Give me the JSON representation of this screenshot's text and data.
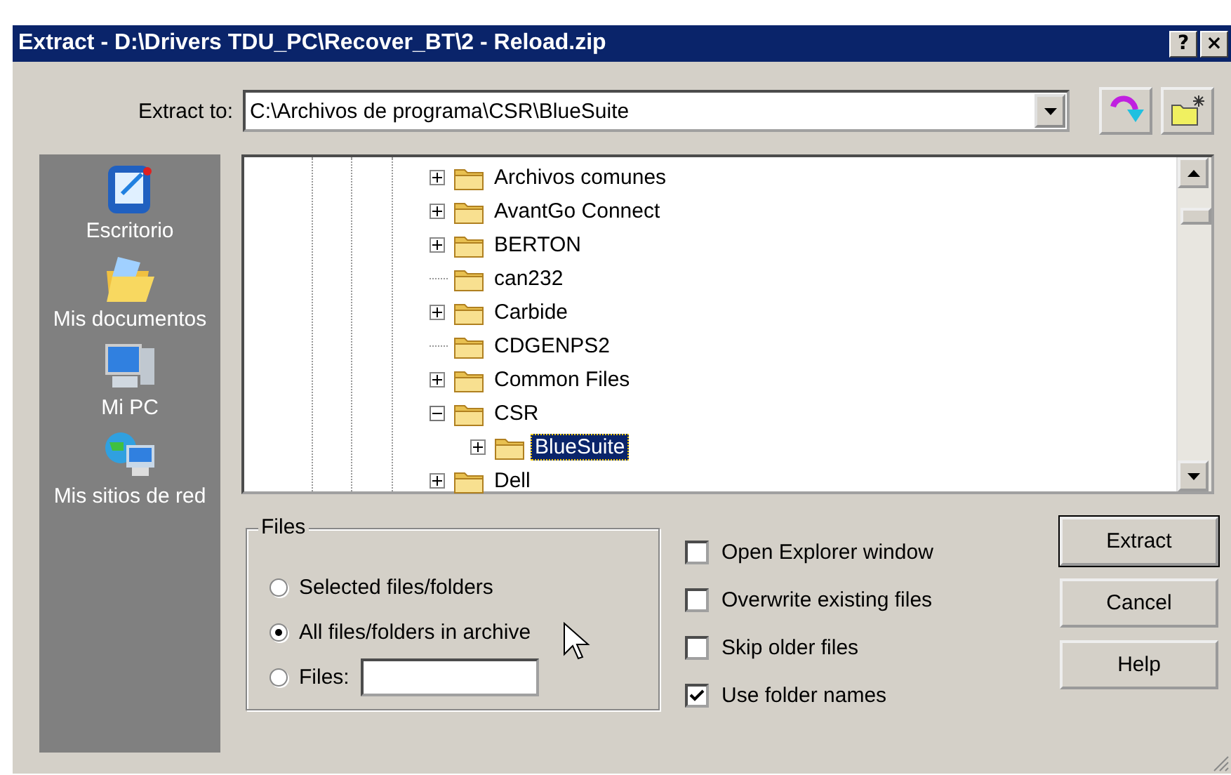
{
  "window": {
    "title": "Extract - D:\\Drivers TDU_PC\\Recover_BT\\2 - Reload.zip",
    "title_buttons": [
      "?",
      "×"
    ]
  },
  "extract_to": {
    "label": "Extract to:",
    "value": "C:\\Archivos de programa\\CSR\\BlueSuite"
  },
  "places": [
    {
      "label": "Escritorio",
      "kind": "desktop"
    },
    {
      "label": "Mis documentos",
      "kind": "documents"
    },
    {
      "label": "Mi PC",
      "kind": "computer"
    },
    {
      "label": "Mis sitios de red",
      "kind": "network"
    }
  ],
  "tree": [
    {
      "label": "Archivos comunes",
      "expandable": true,
      "expanded": false,
      "selected": false
    },
    {
      "label": "AvantGo Connect",
      "expandable": true,
      "expanded": false,
      "selected": false
    },
    {
      "label": "BERTON",
      "expandable": true,
      "expanded": false,
      "selected": false
    },
    {
      "label": "can232",
      "expandable": false,
      "selected": false
    },
    {
      "label": "Carbide",
      "expandable": true,
      "expanded": false,
      "selected": false
    },
    {
      "label": "CDGENPS2",
      "expandable": false,
      "selected": false
    },
    {
      "label": "Common Files",
      "expandable": true,
      "expanded": false,
      "selected": false
    },
    {
      "label": "CSR",
      "expandable": true,
      "expanded": true,
      "selected": false,
      "children": [
        {
          "label": "BlueSuite",
          "expandable": true,
          "expanded": false,
          "selected": true
        }
      ]
    },
    {
      "label": "Dell",
      "expandable": true,
      "expanded": false,
      "selected": false
    }
  ],
  "files_group": {
    "title": "Files",
    "options": [
      {
        "label": "Selected files/folders",
        "selected": false
      },
      {
        "label": "All files/folders in archive",
        "selected": true
      },
      {
        "label": "Files:",
        "selected": false,
        "has_field": true
      }
    ]
  },
  "options": [
    {
      "label": "Open Explorer window",
      "checked": false
    },
    {
      "label": "Overwrite existing files",
      "checked": false
    },
    {
      "label": "Skip older files",
      "checked": false
    },
    {
      "label": "Use folder names",
      "checked": true
    }
  ],
  "buttons": [
    {
      "label": "Extract",
      "default": true
    },
    {
      "label": "Cancel",
      "default": false
    },
    {
      "label": "Help",
      "default": false
    }
  ]
}
